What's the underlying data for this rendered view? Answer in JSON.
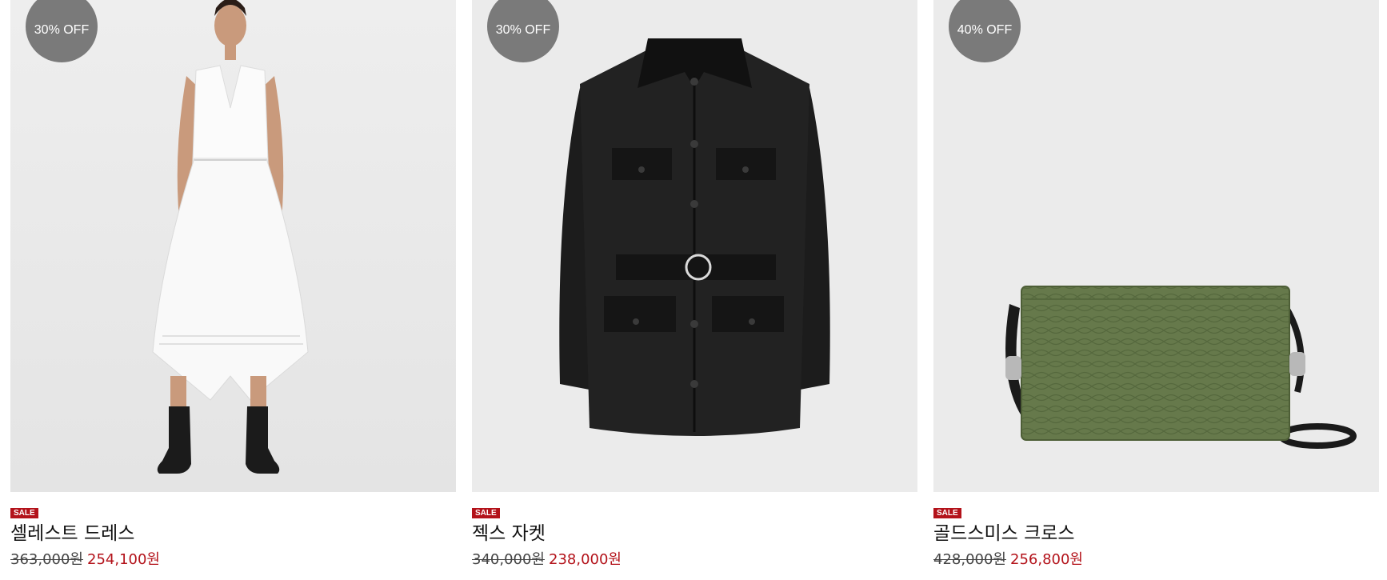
{
  "products": [
    {
      "badge": "30% OFF",
      "tag": "SALE",
      "name": "셀레스트 드레스",
      "original_price": "363,000원",
      "sale_price": "254,100원",
      "image": "white-dress-model-photo"
    },
    {
      "badge": "30% OFF",
      "tag": "SALE",
      "name": "젝스 자켓",
      "original_price": "340,000원",
      "sale_price": "238,000원",
      "image": "black-belted-jacket-photo"
    },
    {
      "badge": "40% OFF",
      "tag": "SALE",
      "name": "골드스미스 크로스",
      "original_price": "428,000원",
      "sale_price": "256,800원",
      "image": "green-snakeskin-crossbody-bag-photo"
    }
  ],
  "colors": {
    "badge_bg": "#7a7a7a",
    "sale_red": "#b3121a",
    "image_bg": "#ebebeb"
  }
}
